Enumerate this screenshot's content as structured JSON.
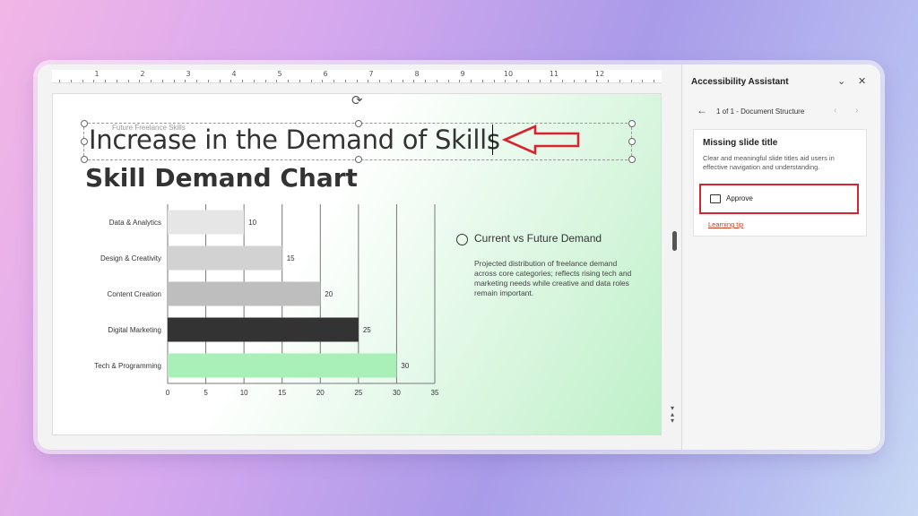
{
  "ruler": {
    "numbers": [
      "1",
      "2",
      "3",
      "4",
      "5",
      "6",
      "7",
      "8",
      "9",
      "10",
      "11",
      "12"
    ]
  },
  "slide": {
    "pretitle": "Future Freelance Skills",
    "title": "Increase in the Demand of Skills",
    "chart_heading": "Skill Demand Chart",
    "legend_title": "Current vs Future Demand",
    "description": "Projected distribution of freelance demand across core categories; reflects rising tech and marketing needs while creative and data roles remain important."
  },
  "chart_data": {
    "type": "bar",
    "orientation": "horizontal",
    "categories": [
      "Data & Analytics",
      "Design & Creativity",
      "Content Creation",
      "Digital Marketing",
      "Tech & Programming"
    ],
    "values": [
      10,
      15,
      20,
      25,
      30
    ],
    "colors": [
      "#e6e6e6",
      "#d2d2d2",
      "#bebebe",
      "#333333",
      "#a8efb8"
    ],
    "xlim": [
      0,
      35
    ],
    "xticks": [
      0,
      5,
      10,
      15,
      20,
      25,
      30,
      35
    ],
    "grid": true,
    "title": "",
    "xlabel": "",
    "ylabel": ""
  },
  "pane": {
    "title": "Accessibility Assistant",
    "nav_label": "1 of 1 - Document Structure",
    "card_title": "Missing slide title",
    "card_text": "Clear and meaningful slide titles aid users in effective navigation and understanding.",
    "approve_label": "Approve",
    "tip_label": "Learning tip"
  },
  "colors": {
    "highlight": "#d9232e",
    "link": "#c43b1c"
  }
}
